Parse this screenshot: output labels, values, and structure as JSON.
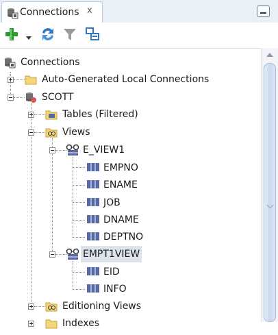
{
  "tab": {
    "title": "Connections",
    "close": "x"
  },
  "toolbar": {
    "add_icon": "add-icon",
    "dropdown_icon": "dropdown-arrow-icon",
    "refresh_icon": "refresh-icon",
    "filter_icon": "filter-icon",
    "schema_icon": "schema-browser-icon"
  },
  "tree": {
    "root": "Connections",
    "auto_generated": "Auto-Generated Local Connections",
    "scott": "SCOTT",
    "tables": "Tables (Filtered)",
    "views": "Views",
    "e_view1": "E_VIEW1",
    "e_view1_cols": [
      "EMPNO",
      "ENAME",
      "JOB",
      "DNAME",
      "DEPTNO"
    ],
    "empt1view": "EMPT1VIEW",
    "empt1view_cols": [
      "EID",
      "INFO"
    ],
    "editioning_views": "Editioning Views",
    "indexes": "Indexes"
  },
  "colors": {
    "tab_bg": "#eaf0f8",
    "selection": "#dde3ea",
    "folder": "#f3d77a",
    "column_icon": "#5569a5"
  }
}
